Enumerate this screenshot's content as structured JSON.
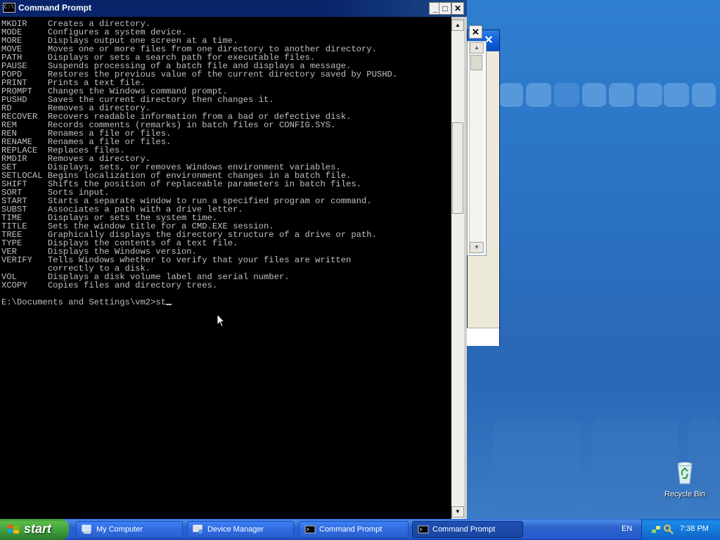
{
  "window": {
    "title": "Command Prompt",
    "app_icon_text": "C:\\",
    "minimize": "_",
    "maximize": "□",
    "close": "✕"
  },
  "terminal": {
    "lines": [
      "MKDIR    Creates a directory.",
      "MODE     Configures a system device.",
      "MORE     Displays output one screen at a time.",
      "MOVE     Moves one or more files from one directory to another directory.",
      "PATH     Displays or sets a search path for executable files.",
      "PAUSE    Suspends processing of a batch file and displays a message.",
      "POPD     Restores the previous value of the current directory saved by PUSHD.",
      "PRINT    Prints a text file.",
      "PROMPT   Changes the Windows command prompt.",
      "PUSHD    Saves the current directory then changes it.",
      "RD       Removes a directory.",
      "RECOVER  Recovers readable information from a bad or defective disk.",
      "REM      Records comments (remarks) in batch files or CONFIG.SYS.",
      "REN      Renames a file or files.",
      "RENAME   Renames a file or files.",
      "REPLACE  Replaces files.",
      "RMDIR    Removes a directory.",
      "SET      Displays, sets, or removes Windows environment variables.",
      "SETLOCAL Begins localization of environment changes in a batch file.",
      "SHIFT    Shifts the position of replaceable parameters in batch files.",
      "SORT     Sorts input.",
      "START    Starts a separate window to run a specified program or command.",
      "SUBST    Associates a path with a drive letter.",
      "TIME     Displays or sets the system time.",
      "TITLE    Sets the window title for a CMD.EXE session.",
      "TREE     Graphically displays the directory structure of a drive or path.",
      "TYPE     Displays the contents of a text file.",
      "VER      Displays the Windows version.",
      "VERIFY   Tells Windows whether to verify that your files are written",
      "         correctly to a disk.",
      "VOL      Displays a disk volume label and serial number.",
      "XCOPY    Copies files and directory trees.",
      "",
      "E:\\Documents and Settings\\vm2>st"
    ]
  },
  "scrollbar": {
    "up": "▲",
    "down": "▼"
  },
  "desktop": {
    "recycle_bin_label": "Recycle Bin"
  },
  "taskbar": {
    "start_label": "start",
    "tasks": [
      {
        "label": "My Computer",
        "icon": "computer-icon"
      },
      {
        "label": "Device Manager",
        "icon": "device-manager-icon"
      },
      {
        "label": "Command Prompt",
        "icon": "cmd-icon"
      },
      {
        "label": "Command Prompt",
        "icon": "cmd-icon"
      }
    ],
    "language": "EN",
    "clock": "7:38 PM"
  }
}
